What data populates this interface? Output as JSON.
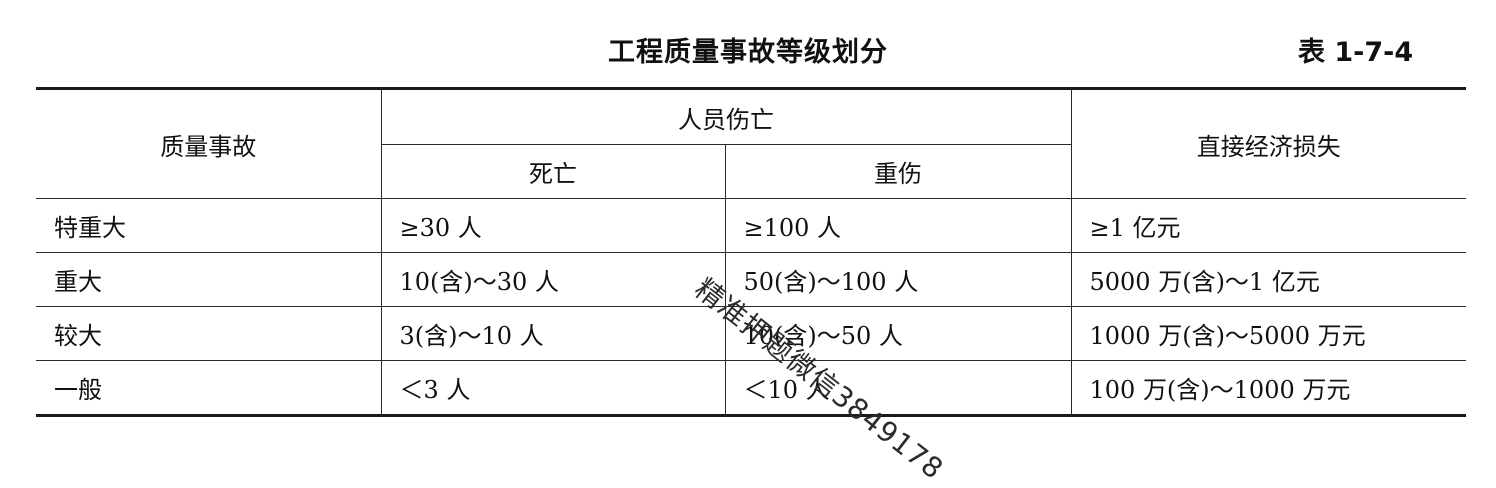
{
  "title": "工程质量事故等级划分",
  "table_no": "表 1-7-4",
  "headers": {
    "category": "质量事故",
    "casualties": "人员伤亡",
    "death": "死亡",
    "injury": "重伤",
    "loss": "直接经济损失"
  },
  "rows": [
    {
      "level": "特重大",
      "death": "≥30 人",
      "injury": "≥100 人",
      "loss": "≥1 亿元"
    },
    {
      "level": "重大",
      "death": "10(含)～30 人",
      "injury": "50(含)～100 人",
      "loss": "5000 万(含)～1 亿元"
    },
    {
      "level": "较大",
      "death": "3(含)～10 人",
      "injury": "10(含)～50 人",
      "loss": "1000 万(含)～5000 万元"
    },
    {
      "level": "一般",
      "death": "＜3 人",
      "injury": "＜10 人",
      "loss": "100 万(含)～1000 万元"
    }
  ],
  "watermark": "精准押题微信3849178"
}
